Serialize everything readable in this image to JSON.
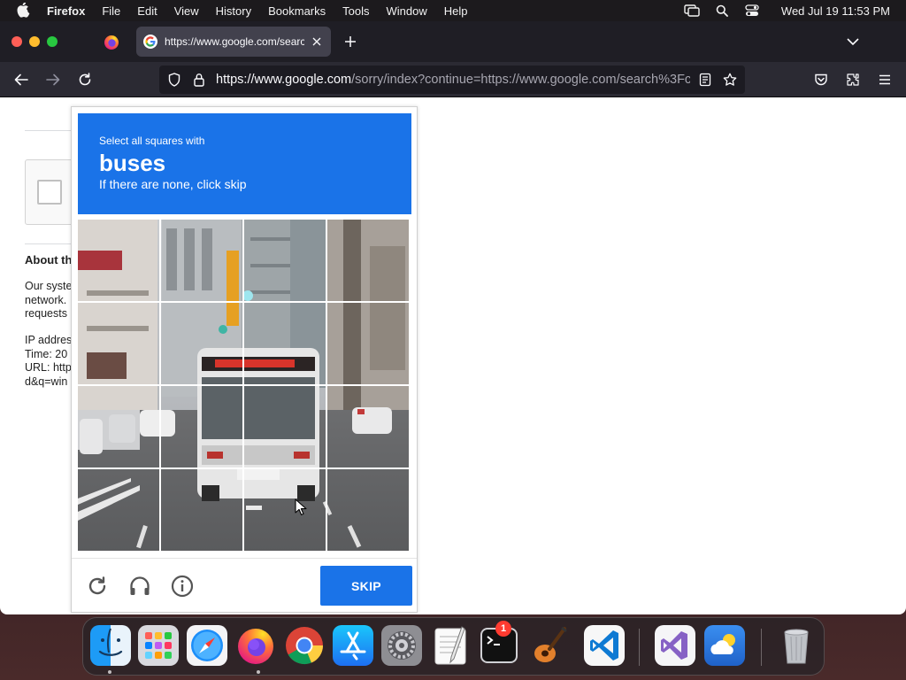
{
  "menubar": {
    "app_name": "Firefox",
    "menus": [
      "File",
      "Edit",
      "View",
      "History",
      "Bookmarks",
      "Tools",
      "Window",
      "Help"
    ],
    "clock": "Wed Jul 19  11:53 PM"
  },
  "browser": {
    "active_tab_title": "https://www.google.com/search",
    "url_host": "https://www.google.com",
    "url_rest": "/sorry/index?continue=https://www.google.com/search%3Fcl"
  },
  "page": {
    "about_heading": "About th",
    "para_lines": [
      "Our syste",
      "network.",
      "requests"
    ],
    "info_lines": [
      "IP addres",
      "Time: 20",
      "URL: http",
      "d&q=win"
    ]
  },
  "challenge": {
    "instruction_prefix": "Select all squares with",
    "target_object": "buses",
    "instruction_suffix": "If there are none, click skip",
    "grid_rows": 4,
    "grid_cols": 4,
    "skip_label": "SKIP",
    "colors": {
      "header_blue": "#1a73e8",
      "button_blue": "#1a73e8"
    }
  },
  "dock": {
    "items": [
      {
        "name": "finder-icon",
        "running": true
      },
      {
        "name": "launchpad-icon",
        "running": false
      },
      {
        "name": "safari-icon",
        "running": false
      },
      {
        "name": "firefox-icon",
        "running": true
      },
      {
        "name": "chrome-icon",
        "running": false
      },
      {
        "name": "app-store-icon",
        "running": false
      },
      {
        "name": "system-settings-icon",
        "running": false,
        "badge": "1"
      },
      {
        "name": "textedit-icon",
        "running": false
      },
      {
        "name": "terminal-icon",
        "running": false
      },
      {
        "name": "garageband-icon",
        "running": false
      },
      {
        "name": "vscode-icon",
        "running": false
      },
      {
        "name": "visual-studio-icon",
        "running": false
      },
      {
        "name": "weather-icon",
        "running": false
      },
      {
        "name": "trash-icon",
        "running": false
      }
    ]
  }
}
